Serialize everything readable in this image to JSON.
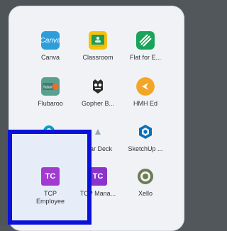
{
  "launcher": {
    "apps": [
      {
        "label": "Canva",
        "icon": "canva-icon",
        "bg": "#2d9edb"
      },
      {
        "label": "Classroom",
        "icon": "classroom-icon",
        "bg": "#1f9d55"
      },
      {
        "label": "Flat for E...",
        "icon": "flat-for-education-icon",
        "bg": "#1aa35a"
      },
      {
        "label": "Flubaroo",
        "icon": "flubaroo-icon",
        "bg": "#5aa08f"
      },
      {
        "label": "Gopher B...",
        "icon": "gopher-buddy-icon",
        "bg": "#2b2b2b"
      },
      {
        "label": "HMH Ed",
        "icon": "hmh-ed-icon",
        "bg": "#f2a628"
      },
      {
        "label": "",
        "icon": "q-icon",
        "bg": "#0aa0c8"
      },
      {
        "label": "ar Deck",
        "icon": "deck-icon",
        "bg": "#9aa6b2"
      },
      {
        "label": "SketchUp ...",
        "icon": "sketchup-icon",
        "bg": "#0b6fb7"
      },
      {
        "label": "TCP Employee",
        "icon": "tcp-employee-icon",
        "bg": "#a03ad0",
        "icon_text": "TC"
      },
      {
        "label": "TCP Mana...",
        "icon": "tcp-manager-icon",
        "bg": "#8b34cc",
        "icon_text": "TC"
      },
      {
        "label": "Xello",
        "icon": "xello-icon",
        "bg": "#6e7c53"
      }
    ],
    "selected_index": 9,
    "labels": {
      "tcp_employee_line1": "TCP",
      "tcp_employee_line2": "Employee",
      "tcp_manager": "TCP Mana...",
      "xello": "Xello",
      "tcp_employee_icon_text": "TC",
      "tcp_manager_icon_text": "TC"
    }
  }
}
